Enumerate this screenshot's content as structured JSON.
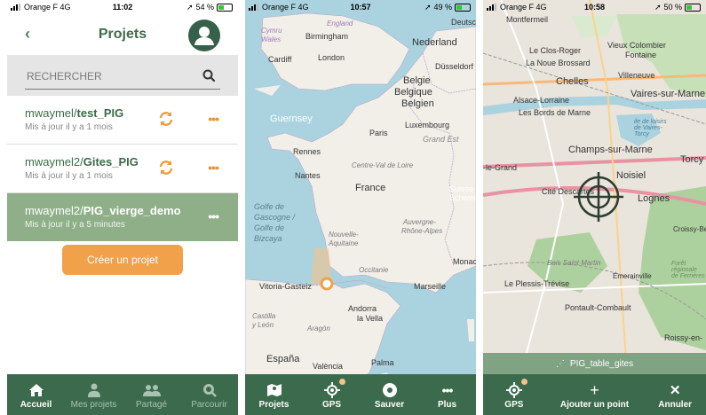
{
  "status": [
    {
      "carrier": "Orange F",
      "network": "4G",
      "time": "11:02",
      "battery": "54 %",
      "battery_level": 0.54
    },
    {
      "carrier": "Orange F",
      "network": "4G",
      "time": "10:57",
      "battery": "49 %",
      "battery_level": 0.49
    },
    {
      "carrier": "Orange F",
      "network": "4G",
      "time": "10:58",
      "battery": "50 %",
      "battery_level": 0.5
    }
  ],
  "projects_screen": {
    "title": "Projets",
    "search_placeholder": "RECHERCHER",
    "projects": [
      {
        "owner": "mwaymel/",
        "name": "test_PIG",
        "updated": "Mis à jour il y a 1 mois"
      },
      {
        "owner": "mwaymel2/",
        "name": "Gites_PIG",
        "updated": "Mis à jour il y a 1 mois"
      },
      {
        "owner": "mwaymel2/",
        "name": "PIG_vierge_demo",
        "updated": "Mis à jour il y a 5 minutes",
        "selected": true
      }
    ],
    "create_button": "Créer un projet",
    "tabs": [
      {
        "label": "Accueil",
        "icon": "home-icon",
        "active": true
      },
      {
        "label": "Mes projets",
        "icon": "user-icon"
      },
      {
        "label": "Partagé",
        "icon": "users-icon"
      },
      {
        "label": "Parcourir",
        "icon": "browse-icon"
      }
    ]
  },
  "map_screen": {
    "labels": [
      "England",
      "Birmingham",
      "Cymru",
      "Wales",
      "Cardiff",
      "London",
      "Nederland",
      "Düsseldorf",
      "Belgie",
      "Belgique",
      "Belgien",
      "Luxembourg",
      "Grand Est",
      "Guernsey",
      "Paris",
      "Rennes",
      "Centre-Val de Loire",
      "Nantes",
      "France",
      "Golfe de",
      "Gascogne /",
      "Golfe de",
      "Bizcaya",
      "Nouvelle-",
      "Aquitaine",
      "Auvergne-",
      "Rhône-Alpes",
      "Occitanie",
      "Monaco",
      "Vitoria-Gasteiz",
      "Andorra",
      "la Vella",
      "Marseille",
      "Castilla",
      "y León",
      "Aragón",
      "España",
      "València",
      "Palma",
      "Suisse",
      "Schweiz",
      "Deutsch"
    ],
    "tabs": [
      {
        "label": "Projets",
        "icon": "map-icon"
      },
      {
        "label": "GPS",
        "icon": "gps-icon",
        "badge": true
      },
      {
        "label": "Sauver",
        "icon": "record-icon"
      },
      {
        "label": "Plus",
        "icon": "more-icon"
      }
    ]
  },
  "zoom_screen": {
    "labels": [
      "Montfermeil",
      "Vieux Colombier",
      "Fontaine",
      "Le Clos-Roger",
      "La Noue Brossard",
      "Chelles",
      "Villeneuve",
      "Vaires-sur-Marne",
      "Alsace-Lorraine",
      "Les Bords de Marne",
      "Champs-sur-Marne",
      "Noisiel",
      "Torcy",
      "Cité Descartes",
      "Lognes",
      "Bois Saint Martin",
      "Émerainville",
      "Le Plessis-Trévise",
      "Pontault-Combault",
      "Roissy-en-",
      "Croissy-Be",
      "Forêt régionale de Ferrières",
      "-le-Grand",
      "ile de loisirs de Vaires-Torcy"
    ],
    "layer_name": "PIG_table_gites",
    "tabs": [
      {
        "label": "GPS",
        "icon": "gps-icon",
        "badge": true
      },
      {
        "label": "Ajouter un point",
        "icon": "plus-icon"
      },
      {
        "label": "Annuler",
        "icon": "close-icon"
      }
    ]
  },
  "colors": {
    "primary": "#3c6a4d",
    "accent": "#f0a14a",
    "selected_row": "#8faf89",
    "sea": "#aad3df",
    "land": "#f2efe9"
  }
}
